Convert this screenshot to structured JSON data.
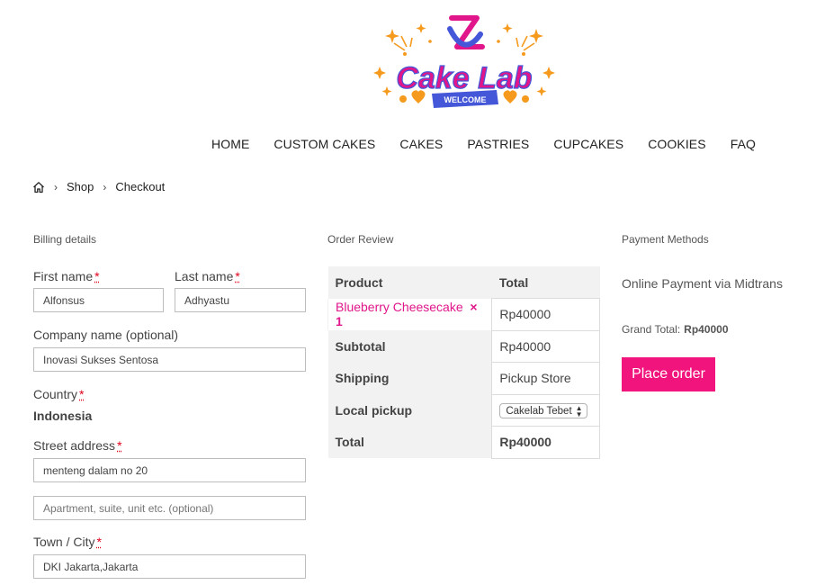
{
  "logo": {
    "name": "Cake Lab",
    "welcome": "WELCOME",
    "colors": {
      "pink": "#e0168a",
      "blue": "#4457d8",
      "orange": "#f59a1c"
    }
  },
  "nav": [
    "HOME",
    "CUSTOM CAKES",
    "CAKES",
    "PASTRIES",
    "CUPCAKES",
    "COOKIES",
    "FAQ"
  ],
  "breadcrumb": {
    "home_icon": "home-icon",
    "items": [
      "Shop",
      "Checkout"
    ]
  },
  "billing": {
    "title": "Billing details",
    "first_name": {
      "label": "First name",
      "value": "Alfonsus"
    },
    "last_name": {
      "label": "Last name",
      "value": "Adhyastu"
    },
    "company": {
      "label": "Company name (optional)",
      "value": "Inovasi Sukses Sentosa"
    },
    "country": {
      "label": "Country",
      "value": "Indonesia"
    },
    "street": {
      "label": "Street address",
      "value": "menteng dalam no 20",
      "placeholder2": "Apartment, suite, unit etc. (optional)"
    },
    "town": {
      "label": "Town / City",
      "value": "DKI Jakarta,Jakarta"
    },
    "required_mark": "*"
  },
  "order": {
    "title": "Order Review",
    "head": {
      "product": "Product",
      "total": "Total"
    },
    "item": {
      "name": "Blueberry Cheesecake",
      "qty": "× 1",
      "price": "Rp40000"
    },
    "subtotal": {
      "label": "Subtotal",
      "value": "Rp40000"
    },
    "shipping": {
      "label": "Shipping",
      "value": "Pickup Store"
    },
    "pickup": {
      "label": "Local pickup",
      "selected": "Cakelab Tebet"
    },
    "total": {
      "label": "Total",
      "value": "Rp40000"
    }
  },
  "payment": {
    "title": "Payment Methods",
    "method": "Online Payment via Midtrans",
    "grand_total_label": "Grand Total:",
    "grand_total_value": "Rp40000",
    "place_order": "Place order",
    "button_color": "#f0147c"
  }
}
